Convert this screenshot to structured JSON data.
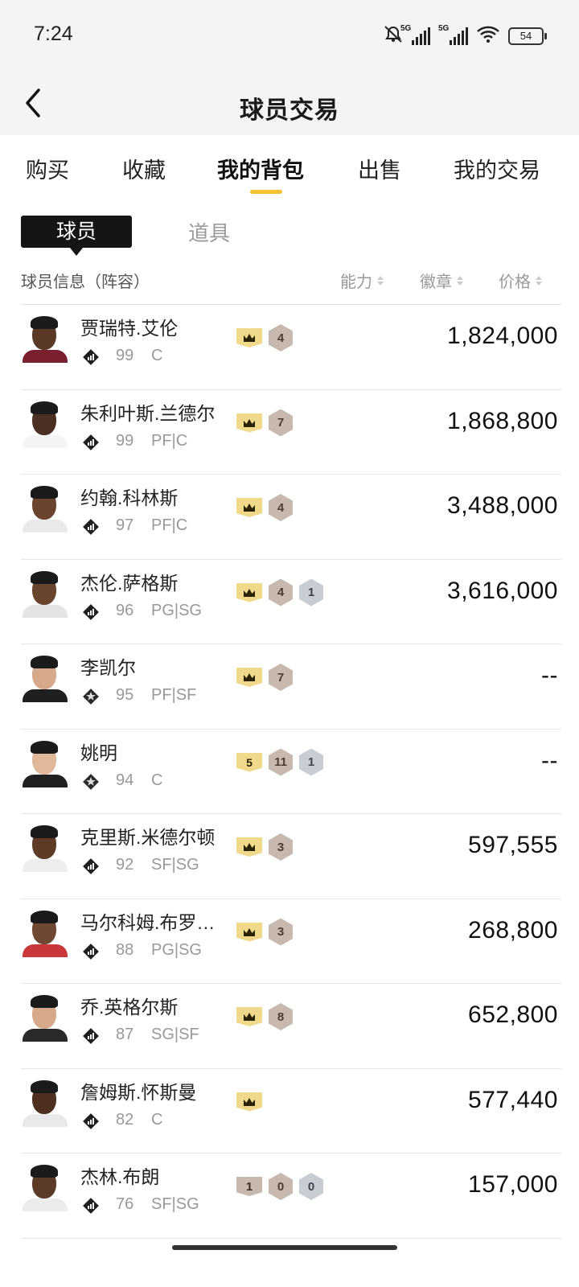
{
  "status": {
    "time": "7:24",
    "battery": "54",
    "net1": "5G",
    "net2": "5G"
  },
  "header": {
    "title": "球员交易"
  },
  "tabs": [
    {
      "label": "购买"
    },
    {
      "label": "收藏"
    },
    {
      "label": "我的背包",
      "active": true
    },
    {
      "label": "出售"
    },
    {
      "label": "我的交易"
    }
  ],
  "subtabs": {
    "players": "球员",
    "items": "道具"
  },
  "columns": {
    "info": "球员信息（阵容）",
    "ability": "能力",
    "badge": "徽章",
    "price": "价格"
  },
  "players": [
    {
      "name": "贾瑞特.艾伦",
      "rating": "99",
      "pos": "C",
      "crown": "",
      "hex1": "4",
      "hex2": "",
      "price": "1,824,000",
      "skin": "#5a3a26",
      "jersey": "#7a1f2e"
    },
    {
      "name": "朱利叶斯.兰德尔",
      "rating": "99",
      "pos": "PF|C",
      "crown": "",
      "hex1": "7",
      "hex2": "",
      "price": "1,868,800",
      "skin": "#4a2f22",
      "jersey": "#f4f4f4"
    },
    {
      "name": "约翰.科林斯",
      "rating": "97",
      "pos": "PF|C",
      "crown": "",
      "hex1": "4",
      "hex2": "",
      "price": "3,488,000",
      "skin": "#6a442c",
      "jersey": "#e9e9e9"
    },
    {
      "name": "杰伦.萨格斯",
      "rating": "96",
      "pos": "PG|SG",
      "crown": "",
      "hex1": "4",
      "hex2": "1",
      "price": "3,616,000",
      "skin": "#6a452e",
      "jersey": "#e4e4e4"
    },
    {
      "name": "李凯尔",
      "rating": "95",
      "pos": "PF|SF",
      "crown": "",
      "hex1": "7",
      "hex2": "",
      "price": "--",
      "skin": "#d7a98b",
      "jersey": "#1f1f1f"
    },
    {
      "name": "姚明",
      "rating": "94",
      "pos": "C",
      "crown": "5",
      "hex1": "11",
      "hex2": "1",
      "price": "--",
      "skin": "#e1b89a",
      "jersey": "#202020"
    },
    {
      "name": "克里斯.米德尔顿",
      "rating": "92",
      "pos": "SF|SG",
      "crown": "",
      "hex1": "3",
      "hex2": "",
      "price": "597,555",
      "skin": "#5d3b26",
      "jersey": "#ededed"
    },
    {
      "name": "马尔科姆.布罗格登",
      "rating": "88",
      "pos": "PG|SG",
      "crown": "",
      "hex1": "3",
      "hex2": "",
      "price": "268,800",
      "skin": "#6e4831",
      "jersey": "#c8373a"
    },
    {
      "name": "乔.英格尔斯",
      "rating": "87",
      "pos": "SG|SF",
      "crown": "",
      "hex1": "8",
      "hex2": "",
      "price": "652,800",
      "skin": "#d5a98a",
      "jersey": "#2a2a2a"
    },
    {
      "name": "詹姆斯.怀斯曼",
      "rating": "82",
      "pos": "C",
      "crown": "",
      "hex1": "",
      "hex2": "",
      "price": "577,440",
      "skin": "#4e3020",
      "jersey": "#e9e9e9"
    },
    {
      "name": "杰林.布朗",
      "rating": "76",
      "pos": "SF|SG",
      "crown": "1",
      "hex1": "0",
      "hex2": "0",
      "price": "157,000",
      "skin": "#5a3b28",
      "jersey": "#ececec"
    }
  ],
  "colors": {
    "accent": "#f2c230",
    "crown": "#f1d98c",
    "bronze": "#c7b9ad",
    "silver": "#c8ccd3"
  }
}
